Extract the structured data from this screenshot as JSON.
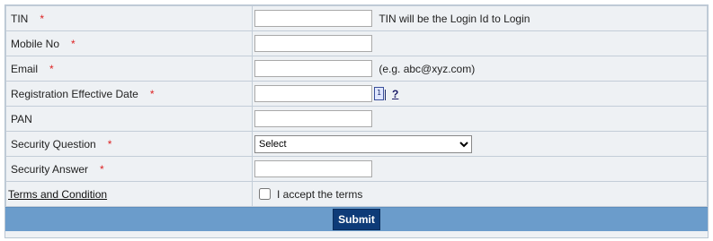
{
  "form": {
    "tin": {
      "label": "TIN",
      "required_mark": "*",
      "value": "",
      "hint": "TIN will be the Login Id to Login"
    },
    "mobile": {
      "label": "Mobile No",
      "required_mark": "*",
      "value": ""
    },
    "email": {
      "label": "Email",
      "required_mark": "*",
      "value": "",
      "hint": "(e.g. abc@xyz.com)"
    },
    "reg_date": {
      "label": "Registration Effective Date",
      "required_mark": "*",
      "value": "",
      "calendar_icon_text": "1",
      "help_label": "?"
    },
    "pan": {
      "label": "PAN",
      "value": ""
    },
    "security_question": {
      "label": "Security Question",
      "required_mark": "*",
      "selected": "Select"
    },
    "security_answer": {
      "label": "Security Answer",
      "required_mark": "*",
      "value": ""
    },
    "terms": {
      "link_label": "Terms and Condition",
      "checkbox_label": "I accept the terms",
      "checked": false
    },
    "submit_label": "Submit"
  },
  "colors": {
    "required": "#d22222",
    "submit_bar": "#6b9ccb",
    "submit_button": "#0e3b78",
    "form_background": "#eef1f4"
  },
  "icons": {
    "calendar": "calendar-icon",
    "help": "help-icon"
  }
}
